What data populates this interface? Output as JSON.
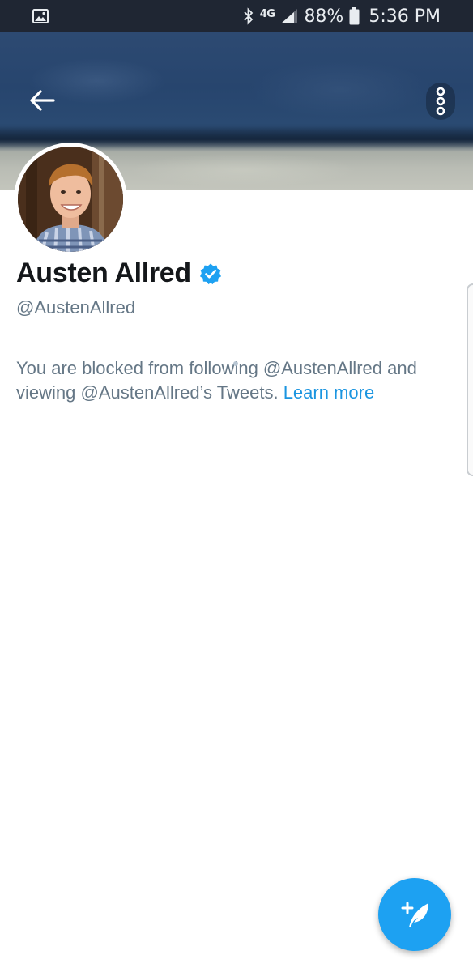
{
  "status_bar": {
    "network": "4G",
    "battery": "88%",
    "time": "5:36 PM",
    "icons": [
      "gallery-icon",
      "bluetooth-icon",
      "signal-icon",
      "battery-icon"
    ]
  },
  "header": {
    "back_icon": "arrow-left-icon",
    "more_icon": "more-vertical-icon",
    "banner_colors": [
      "#2a4a72",
      "#b9bcb4"
    ]
  },
  "profile": {
    "display_name": "Austen Allred",
    "verified": true,
    "handle": "@AustenAllred"
  },
  "blocked": {
    "message": "You are blocked from following @AustenAllred and viewing @AustenAllred’s Tweets.",
    "link_label": "Learn more"
  },
  "compose": {
    "icon": "compose-tweet-icon"
  },
  "colors": {
    "accent": "#1da1f2",
    "link": "#1b95e0",
    "secondary_text": "#657786",
    "divider": "#e1e8ed",
    "status_bar": "#1f2633"
  }
}
